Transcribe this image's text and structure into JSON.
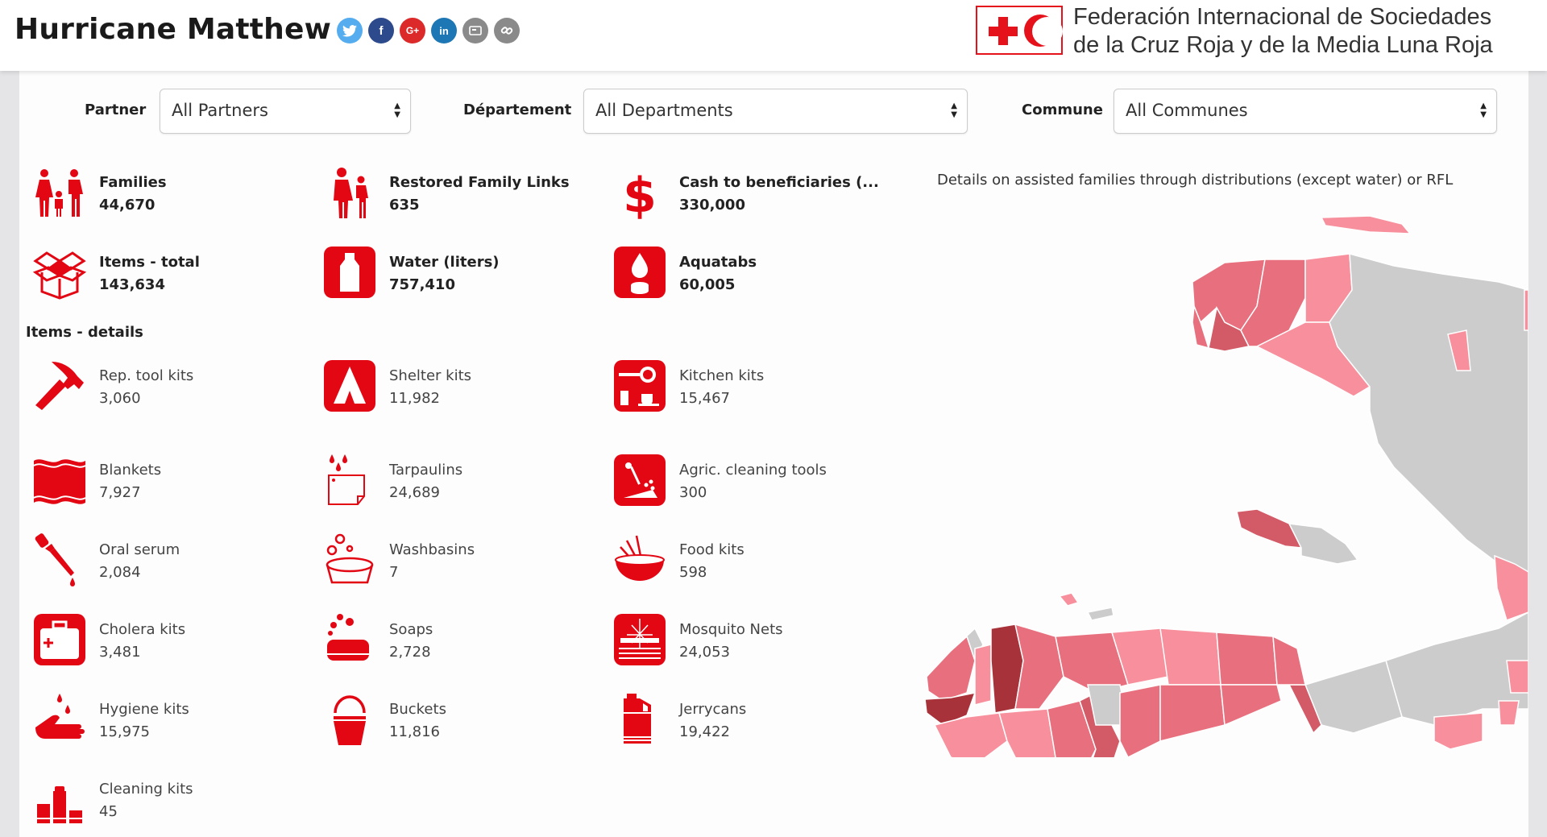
{
  "header": {
    "title": "Hurricane Matthew",
    "social": [
      {
        "name": "twitter",
        "glyph": "t",
        "color": "#55acee"
      },
      {
        "name": "facebook",
        "glyph": "f",
        "color": "#2d4a8c"
      },
      {
        "name": "google-plus",
        "glyph": "G+",
        "color": "#dc2a2a"
      },
      {
        "name": "linkedin",
        "glyph": "in",
        "color": "#1e77b5"
      },
      {
        "name": "email",
        "glyph": "✉",
        "color": "#8a8a8a"
      },
      {
        "name": "link",
        "glyph": "∞",
        "color": "#8a8a8a"
      }
    ],
    "org_line1": "Federación Internacional de Sociedades",
    "org_line2": "de la Cruz Roja y de la Media Luna Roja"
  },
  "filters": {
    "partner": {
      "label": "Partner",
      "value": "All Partners"
    },
    "departement": {
      "label": "Département",
      "value": "All Departments"
    },
    "commune": {
      "label": "Commune",
      "value": "All Communes"
    }
  },
  "summary": [
    {
      "label": "Families",
      "value": "44,670",
      "icon": "family-icon"
    },
    {
      "label": "Restored Family Links",
      "value": "635",
      "icon": "parent-child-icon"
    },
    {
      "label": "Cash to beneficiaries (...",
      "value": "330,000",
      "icon": "dollar-icon"
    },
    {
      "label": "Items - total",
      "value": "143,634",
      "icon": "box-icon"
    },
    {
      "label": "Water (liters)",
      "value": "757,410",
      "icon": "water-bottle-icon"
    },
    {
      "label": "Aquatabs",
      "value": "60,005",
      "icon": "aquatabs-icon"
    }
  ],
  "items_details_label": "Items - details",
  "items": [
    {
      "label": "Rep. tool kits",
      "value": "3,060",
      "icon": "hammer-icon"
    },
    {
      "label": "Shelter kits",
      "value": "11,982",
      "icon": "tent-icon"
    },
    {
      "label": "Kitchen kits",
      "value": "15,467",
      "icon": "kitchen-icon"
    },
    {
      "label": "Blankets",
      "value": "7,927",
      "icon": "blanket-icon"
    },
    {
      "label": "Tarpaulins",
      "value": "24,689",
      "icon": "tarpaulin-icon"
    },
    {
      "label": "Agric. cleaning tools",
      "value": "300",
      "icon": "shovel-icon"
    },
    {
      "label": "Oral serum",
      "value": "2,084",
      "icon": "dropper-icon"
    },
    {
      "label": "Washbasins",
      "value": "7",
      "icon": "washbasin-icon"
    },
    {
      "label": "Food kits",
      "value": "598",
      "icon": "food-bowl-icon"
    },
    {
      "label": "Cholera kits",
      "value": "3,481",
      "icon": "medical-kit-icon"
    },
    {
      "label": "Soaps",
      "value": "2,728",
      "icon": "soap-icon"
    },
    {
      "label": "Mosquito Nets",
      "value": "24,053",
      "icon": "mosquito-net-icon"
    },
    {
      "label": "Hygiene kits",
      "value": "15,975",
      "icon": "hand-wash-icon"
    },
    {
      "label": "Buckets",
      "value": "11,816",
      "icon": "bucket-icon"
    },
    {
      "label": "Jerrycans",
      "value": "19,422",
      "icon": "jerrycan-icon"
    },
    {
      "label": "Cleaning kits",
      "value": "45",
      "icon": "cleaning-kit-icon"
    }
  ],
  "map": {
    "caption": "Details on assisted families through distributions (except water) or RFL",
    "colors": {
      "none": "#cccccc",
      "low": "#f7909c",
      "mid": "#e8707e",
      "high": "#d35a67",
      "max": "#a8323a"
    }
  },
  "colors": {
    "accent": "#e30613",
    "background": "#fdfdfd",
    "side_strip": "#e5e5e7"
  }
}
